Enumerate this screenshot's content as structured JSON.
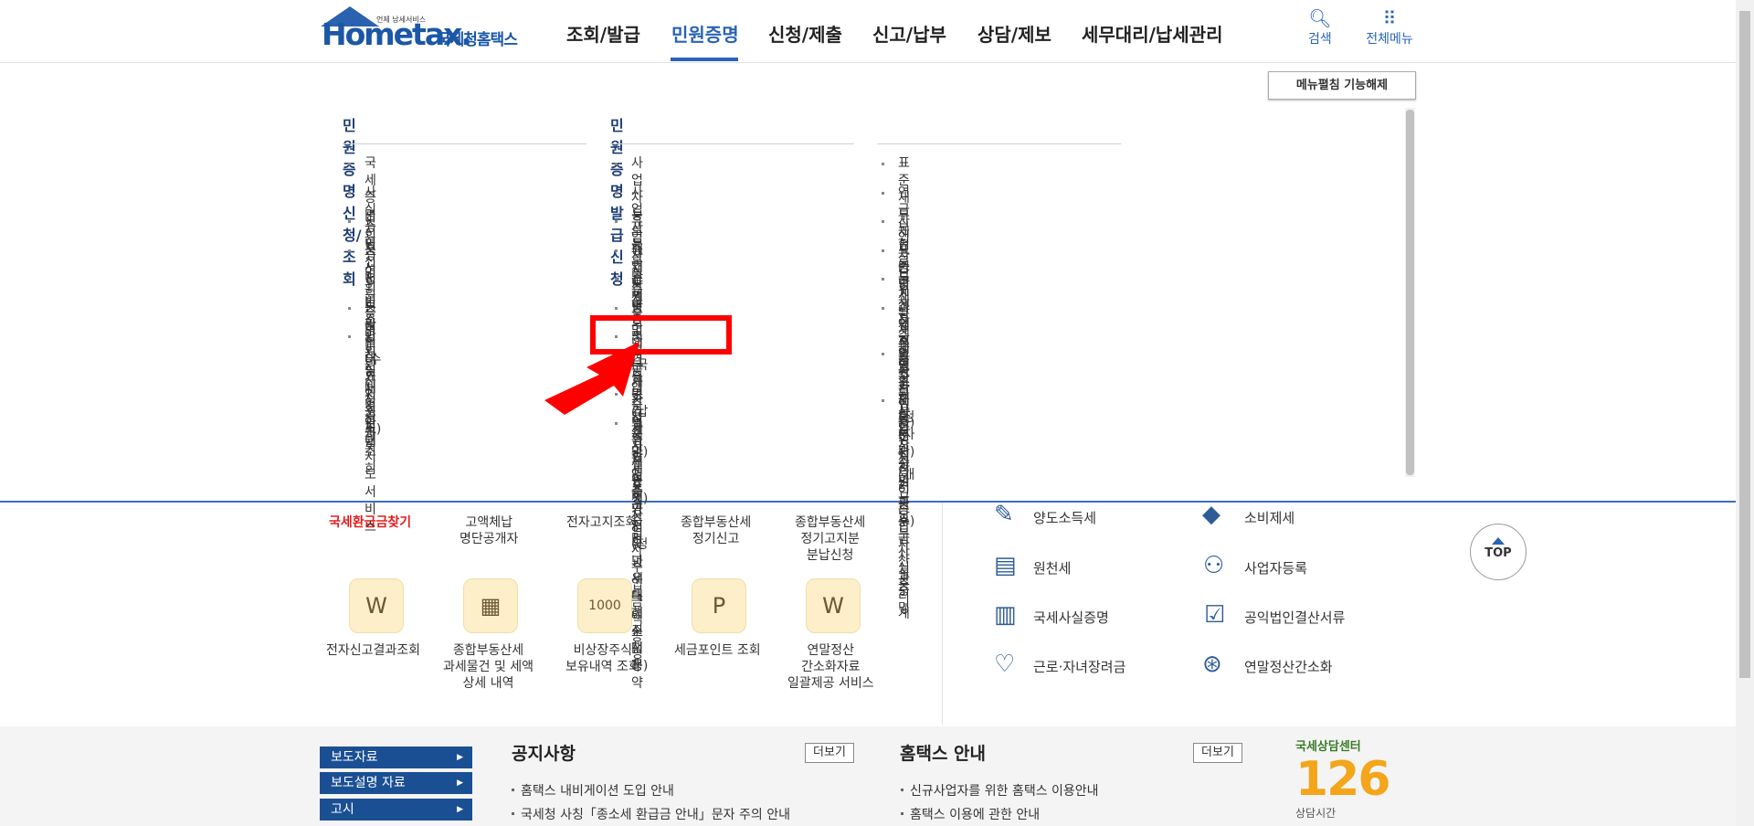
{
  "header": {
    "logo_text": "Hometax.",
    "logo_small": "언제 남세서비스",
    "logo_kr": "국세청홈택스",
    "nav": [
      "조회/발급",
      "민원증명",
      "신청/제출",
      "신고/납부",
      "상담/제보",
      "세무대리/납세관리"
    ],
    "search_label": "검색",
    "allmenu_label": "전체메뉴"
  },
  "mega": {
    "cancel_label": "메뉴펼침 기능해제",
    "col1_title": "민원증명 신청/조회",
    "col1_items": [
      "국세증명신청",
      "사실증명신청",
      "민원증명 원본확인(수요처 조회)",
      "문서위변조방지 및 처벌안내",
      "민원증명 민원신청결과조회",
      "민원실 대기인원 조회",
      "민원실대기인원지도서비스"
    ],
    "col2_title": "민원증명발급신청",
    "col2_items": [
      "사업자등록증 재발급",
      "사업자등록증명",
      "휴업사실증명",
      "폐업사실증명",
      "납세증명서(국세완납증명)",
      "납부내역증명(납세사실증명)",
      "소득금액증명",
      "부가가치세 과세표준증명",
      "부가가치세 면세사업자 수입금액증명",
      "소득확인증명서(청년우대형주택청약",
      "종합저축 가입 및 과세특례 신청용)"
    ],
    "col3_items": [
      "표준재무제표증명",
      "연금보험료등 소득·세액 공제확인서",
      "사업자단위과세 적용 종된사업장증명",
      "모범납세자증명",
      "국세납세증명 조회(정부관리기관용)",
      "취업후학자금상환_상환금납부사실증",
      "명서",
      "소득확인증명서(개인종합자산관리계",
      "좌 가입용)",
      "근로(자녀)장려금 수급사실 증명"
    ]
  },
  "quick": {
    "row1": [
      "국세환급금찾기",
      "고액체납",
      "명단공개자",
      "전자고지조회",
      "종합부동산세",
      "정기신고",
      "종합부동산세",
      "정기고지분",
      "분납신청"
    ],
    "row2": [
      "전자신고결과조회",
      "종합부동산세",
      "과세물건 및 세액",
      "상세 내역",
      "비상장주식",
      "보유내역 조회",
      "세금포인트 조회",
      "연말정산",
      "간소화자료",
      "일괄제공 서비스"
    ],
    "icons": [
      "W",
      "▦",
      "1000",
      "P",
      "W"
    ]
  },
  "tax": [
    "양도소득세",
    "소비제세",
    "원천세",
    "사업자등록",
    "국세사실증명",
    "공익법인결산서류",
    "근로·자녀장려금",
    "연말정산간소화"
  ],
  "top_label": "TOP",
  "bottom": {
    "side_buttons": [
      "보도자료",
      "보도설명 자료",
      "고시"
    ],
    "notice_title": "공지사항",
    "notice_more": "더보기",
    "notices": [
      "홈택스 내비게이션 도입 안내",
      "국세청 사칭「종소세 환급금 안내」문자 주의 안내"
    ],
    "guide_title": "홈택스 안내",
    "guide_more": "더보기",
    "guides": [
      "신규사업자를 위한 홈택스 이용안내",
      "홈택스 이용에 관한 안내"
    ],
    "center_label": "국세상담센터",
    "center_number": "126",
    "center_sub": "상담시간"
  }
}
